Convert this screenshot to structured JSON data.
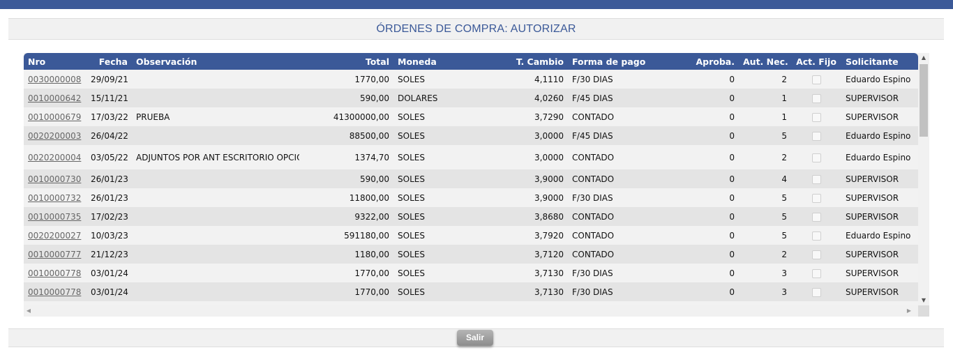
{
  "header": {
    "title": "ÓRDENES DE COMPRA: AUTORIZAR"
  },
  "columns": [
    "Nro",
    "Fecha",
    "Observación",
    "Total",
    "Moneda",
    "T. Cambio",
    "Forma de pago",
    "Aproba.",
    "Aut. Nec.",
    "Act. Fijo",
    "Solicitante"
  ],
  "rows": [
    {
      "nro": "0030000008",
      "fecha": "29/09/21",
      "obs": "",
      "total": "1770,00",
      "moneda": "SOLES",
      "tcambio": "4,1110",
      "forma": "F/30 DIAS",
      "aproba": "0",
      "autnec": "2",
      "solicitante": "Eduardo Espino"
    },
    {
      "nro": "0010000642",
      "fecha": "15/11/21",
      "obs": "",
      "total": "590,00",
      "moneda": "DOLARES",
      "tcambio": "4,0260",
      "forma": "F/45 DIAS",
      "aproba": "0",
      "autnec": "1",
      "solicitante": "SUPERVISOR"
    },
    {
      "nro": "0010000679",
      "fecha": "17/03/22",
      "obs": "PRUEBA",
      "total": "41300000,00",
      "moneda": "SOLES",
      "tcambio": "3,7290",
      "forma": "CONTADO",
      "aproba": "0",
      "autnec": "1",
      "solicitante": "SUPERVISOR"
    },
    {
      "nro": "0020200003",
      "fecha": "26/04/22",
      "obs": "",
      "total": "88500,00",
      "moneda": "SOLES",
      "tcambio": "3,0000",
      "forma": "F/45 DIAS",
      "aproba": "0",
      "autnec": "5",
      "solicitante": "Eduardo Espino"
    },
    {
      "nro": "0020200004",
      "fecha": "03/05/22",
      "obs": "ADJUNTOS POR ANT ESCRITORIO OPCION PREORDEN",
      "total": "1374,70",
      "moneda": "SOLES",
      "tcambio": "3,0000",
      "forma": "CONTADO",
      "aproba": "0",
      "autnec": "2",
      "solicitante": "Eduardo Espino"
    },
    {
      "nro": "0010000730",
      "fecha": "26/01/23",
      "obs": "",
      "total": "590,00",
      "moneda": "SOLES",
      "tcambio": "3,9000",
      "forma": "CONTADO",
      "aproba": "0",
      "autnec": "4",
      "solicitante": "SUPERVISOR"
    },
    {
      "nro": "0010000732",
      "fecha": "26/01/23",
      "obs": "",
      "total": "11800,00",
      "moneda": "SOLES",
      "tcambio": "3,9000",
      "forma": "F/30 DIAS",
      "aproba": "0",
      "autnec": "5",
      "solicitante": "SUPERVISOR"
    },
    {
      "nro": "0010000735",
      "fecha": "17/02/23",
      "obs": "",
      "total": "9322,00",
      "moneda": "SOLES",
      "tcambio": "3,8680",
      "forma": "CONTADO",
      "aproba": "0",
      "autnec": "5",
      "solicitante": "SUPERVISOR"
    },
    {
      "nro": "0020200027",
      "fecha": "10/03/23",
      "obs": "",
      "total": "591180,00",
      "moneda": "SOLES",
      "tcambio": "3,7920",
      "forma": "CONTADO",
      "aproba": "0",
      "autnec": "5",
      "solicitante": "Eduardo Espino"
    },
    {
      "nro": "0010000777",
      "fecha": "21/12/23",
      "obs": "",
      "total": "1180,00",
      "moneda": "SOLES",
      "tcambio": "3,7120",
      "forma": "CONTADO",
      "aproba": "0",
      "autnec": "2",
      "solicitante": "SUPERVISOR"
    },
    {
      "nro": "0010000778",
      "fecha": "03/01/24",
      "obs": "",
      "total": "1770,00",
      "moneda": "SOLES",
      "tcambio": "3,7130",
      "forma": "F/30 DIAS",
      "aproba": "0",
      "autnec": "3",
      "solicitante": "SUPERVISOR"
    },
    {
      "nro": "0010000778",
      "fecha": "03/01/24",
      "obs": "",
      "total": "1770,00",
      "moneda": "SOLES",
      "tcambio": "3,7130",
      "forma": "F/30 DIAS",
      "aproba": "0",
      "autnec": "3",
      "solicitante": "SUPERVISOR"
    }
  ],
  "footer": {
    "salir_label": "Salir"
  },
  "icons": {
    "scroll_up": "triangle-up-icon",
    "scroll_down": "triangle-down-icon",
    "scroll_left": "triangle-left-icon",
    "scroll_right": "triangle-right-icon"
  },
  "colors": {
    "primary": "#3b5998"
  }
}
